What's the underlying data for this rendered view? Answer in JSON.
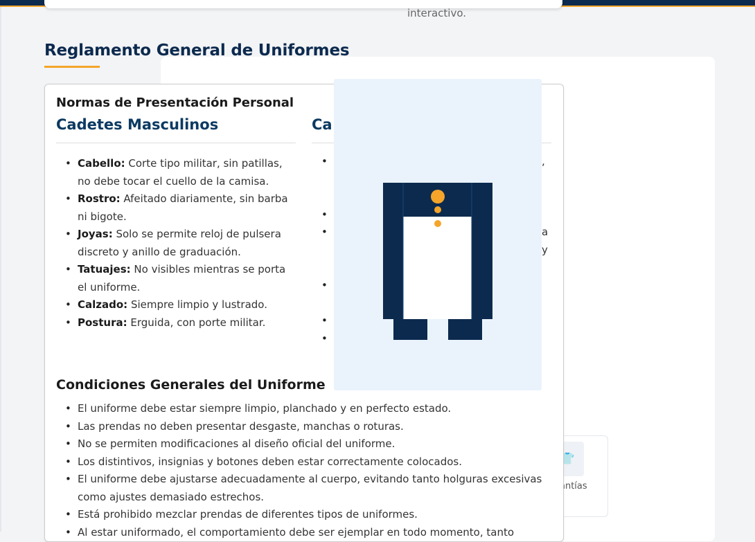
{
  "top_card": {
    "text": "interactivo."
  },
  "section": {
    "title": "Reglamento General de Uniformes"
  },
  "norms": {
    "title": "Normas de Presentación Personal",
    "male": {
      "title": "Cadetes Masculinos",
      "items": [
        {
          "label": "Cabello:",
          "text": " Corte tipo militar, sin patillas, no debe tocar el cuello de la camisa."
        },
        {
          "label": "Rostro:",
          "text": " Afeitado diariamente, sin barba ni bigote."
        },
        {
          "label": "Joyas:",
          "text": " Solo se permite reloj de pulsera discreto y anillo de graduación."
        },
        {
          "label": "Tatuajes:",
          "text": " No visibles mientras se porta el uniforme."
        },
        {
          "label": "Calzado:",
          "text": " Siempre limpio y lustrado."
        },
        {
          "label": "Postura:",
          "text": " Erguida, con porte militar."
        }
      ]
    },
    "female": {
      "title_visible": "Ca",
      "fragments": [
        ",",
        "a",
        "y"
      ]
    }
  },
  "conditions": {
    "title": "Condiciones Generales del Uniforme",
    "items": [
      "El uniforme debe estar siempre limpio, planchado y en perfecto estado.",
      "Las prendas no deben presentar desgaste, manchas o roturas.",
      "No se permiten modificaciones al diseño oficial del uniforme.",
      "Los distintivos, insignias y botones deben estar correctamente colocados.",
      "El uniforme debe ajustarse adecuadamente al cuerpo, evitando tanto holguras excesivas como ajustes demasiado estrechos.",
      "Está prohibido mezclar prendas de diferentes tipos de uniformes.",
      "Al estar uniformado, el comportamiento debe ser ejemplar en todo momento, tanto"
    ]
  },
  "background_card": {
    "icon": "shirt-icon",
    "text": "antías"
  },
  "overlay": {
    "figure": "uniform-figure"
  },
  "colors": {
    "navy": "#0c2a4e",
    "accent": "#f4a52a",
    "overlay_bg": "#eaf3fc"
  }
}
